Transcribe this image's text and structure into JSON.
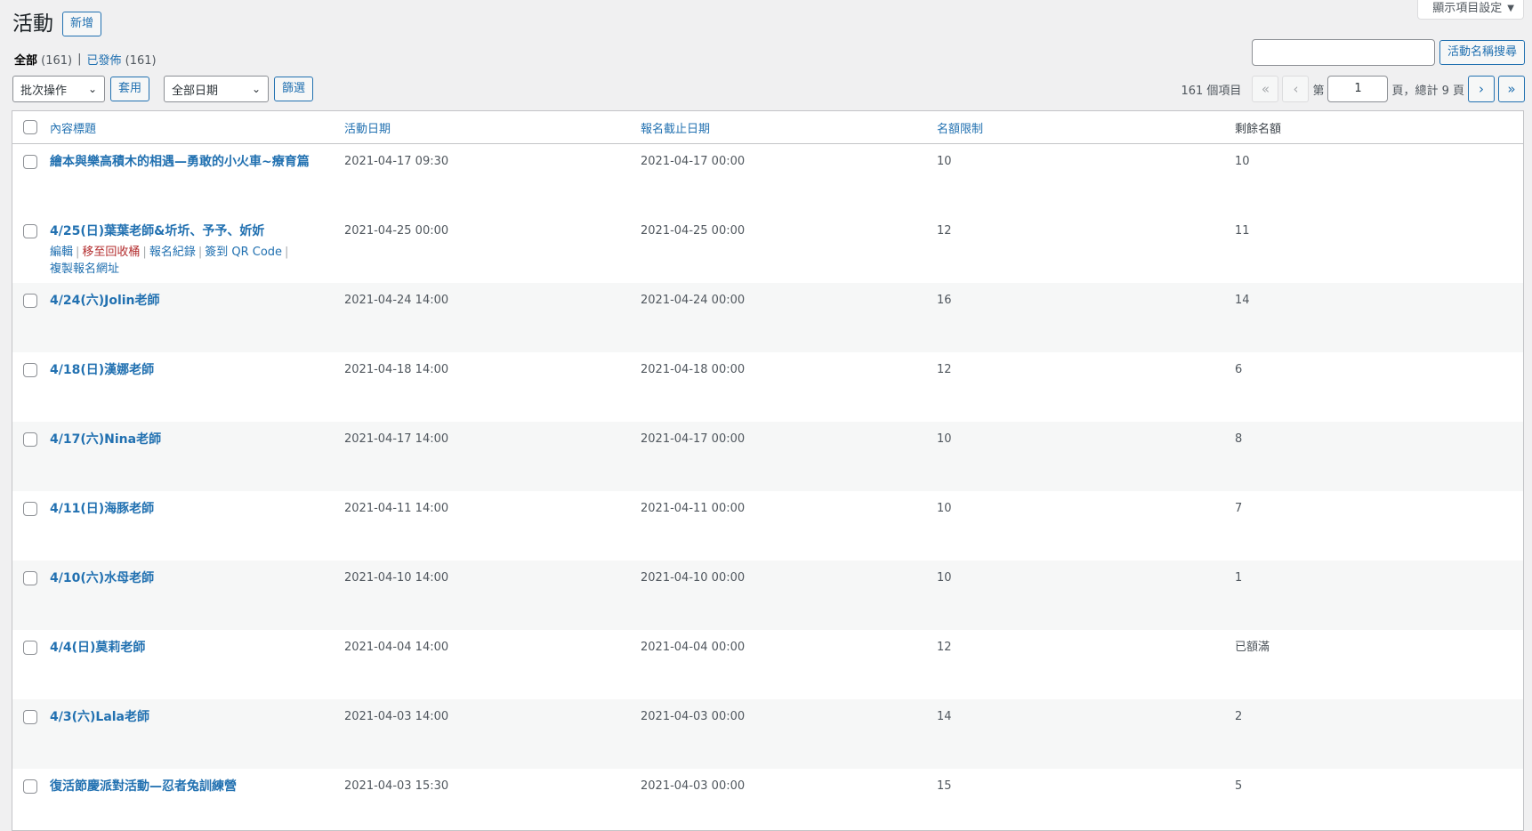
{
  "screen_options": {
    "label": "顯示項目設定"
  },
  "header": {
    "title": "活動",
    "add_new": "新增"
  },
  "views": {
    "all_label": "全部",
    "all_count": "(161)",
    "separator": "|",
    "published_label": "已發佈",
    "published_count": "(161)"
  },
  "search": {
    "value": "",
    "button": "活動名稱搜尋"
  },
  "tablenav": {
    "bulk_action": "批次操作",
    "apply": "套用",
    "date_filter": "全部日期",
    "filter": "篩選",
    "items_count": "161 個項目",
    "first": "«",
    "prev": "‹",
    "page_prefix": "第",
    "current_page": "1",
    "page_suffix": "頁，總計 9 頁",
    "next": "›",
    "last": "»"
  },
  "columns": [
    "內容標題",
    "活動日期",
    "報名截止日期",
    "名額限制",
    "剩餘名額"
  ],
  "row_actions": {
    "edit": "編輯",
    "trash": "移至回收桶",
    "records": "報名紀錄",
    "qr": "簽到 QR Code",
    "copy": "複製報名網址",
    "sep": "|"
  },
  "rows": [
    {
      "title": "繪本與樂高積木的相遇—勇敢的小火車~療育篇",
      "date": "2021-04-17 09:30",
      "deadline": "2021-04-17 00:00",
      "limit": "10",
      "remain": "10"
    },
    {
      "title": "4/25(日)葉葉老師&圻圻、予予、妡妡",
      "date": "2021-04-25 00:00",
      "deadline": "2021-04-25 00:00",
      "limit": "12",
      "remain": "11"
    },
    {
      "title": "4/24(六)Jolin老師",
      "date": "2021-04-24 14:00",
      "deadline": "2021-04-24 00:00",
      "limit": "16",
      "remain": "14"
    },
    {
      "title": "4/18(日)漢娜老師",
      "date": "2021-04-18 14:00",
      "deadline": "2021-04-18 00:00",
      "limit": "12",
      "remain": "6"
    },
    {
      "title": "4/17(六)Nina老師",
      "date": "2021-04-17 14:00",
      "deadline": "2021-04-17 00:00",
      "limit": "10",
      "remain": "8"
    },
    {
      "title": "4/11(日)海豚老師",
      "date": "2021-04-11 14:00",
      "deadline": "2021-04-11 00:00",
      "limit": "10",
      "remain": "7"
    },
    {
      "title": "4/10(六)水母老師",
      "date": "2021-04-10 14:00",
      "deadline": "2021-04-10 00:00",
      "limit": "10",
      "remain": "1"
    },
    {
      "title": "4/4(日)莫莉老師",
      "date": "2021-04-04 14:00",
      "deadline": "2021-04-04 00:00",
      "limit": "12",
      "remain": "已額滿"
    },
    {
      "title": "4/3(六)Lala老師",
      "date": "2021-04-03 14:00",
      "deadline": "2021-04-03 00:00",
      "limit": "14",
      "remain": "2"
    },
    {
      "title": "復活節慶派對活動—忍者兔訓練營",
      "date": "2021-04-03 15:30",
      "deadline": "2021-04-03 00:00",
      "limit": "15",
      "remain": "5"
    }
  ]
}
